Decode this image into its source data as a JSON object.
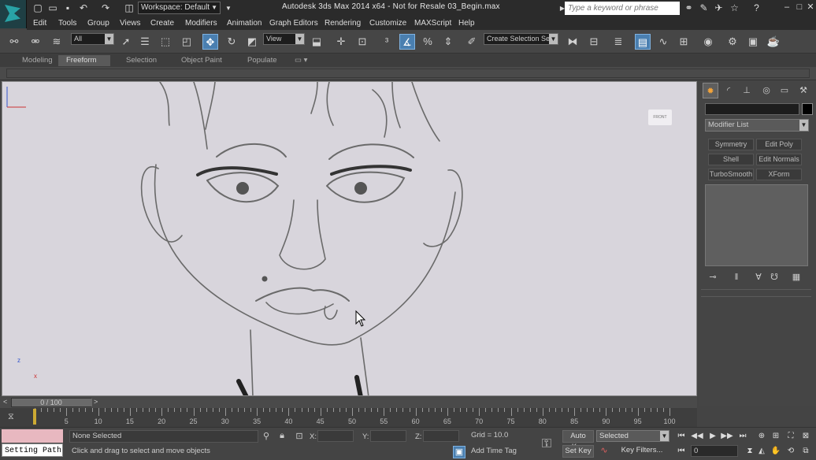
{
  "title": {
    "text": "Autodesk 3ds Max  2014 x64  - Not for Resale    03_Begin.max",
    "workspace": "Workspace: Default",
    "search_placeholder": "Type a keyword or phrase"
  },
  "menu": [
    "Edit",
    "Tools",
    "Group",
    "Views",
    "Create",
    "Modifiers",
    "Animation",
    "Graph Editors",
    "Rendering",
    "Customize",
    "MAXScript",
    "Help"
  ],
  "toolbar": {
    "filter": "All",
    "ref_coord": "View",
    "selection_set": "Create Selection Se"
  },
  "ribbon_tabs": [
    "Modeling",
    "Freeform",
    "Selection",
    "Object Paint",
    "Populate"
  ],
  "ribbon_active": "Freeform",
  "viewport": {
    "viewcube_label": "FRONT",
    "axis_x": "x",
    "axis_z": "z"
  },
  "command_panel": {
    "modifier_list": "Modifier List",
    "buttons": [
      "Symmetry",
      "Edit Poly",
      "Shell",
      "Edit Normals",
      "TurboSmooth",
      "XForm"
    ]
  },
  "time_slider": {
    "position": "0 / 100",
    "fraction": 0.0
  },
  "timeline": {
    "ticks": [
      0,
      5,
      10,
      15,
      20,
      25,
      30,
      35,
      40,
      45,
      50,
      55,
      60,
      65,
      70,
      75,
      80,
      85,
      90,
      95,
      100
    ],
    "current_frame": 0
  },
  "status": {
    "selection": "None Selected",
    "prompt": "Click and drag to select and move objects",
    "setting_path": "Setting Path",
    "x_label": "X:",
    "y_label": "Y:",
    "z_label": "Z:",
    "grid": "Grid = 10.0",
    "add_time_tag": "Add Time Tag",
    "auto_key": "Auto Key",
    "set_key": "Set Key",
    "selected": "Selected",
    "key_filters": "Key Filters...",
    "frame": "0"
  },
  "colors": {
    "accent": "#4a7fb0",
    "maxscript": "#e8b8c0",
    "viewport_bg": "#d8d5dc"
  }
}
